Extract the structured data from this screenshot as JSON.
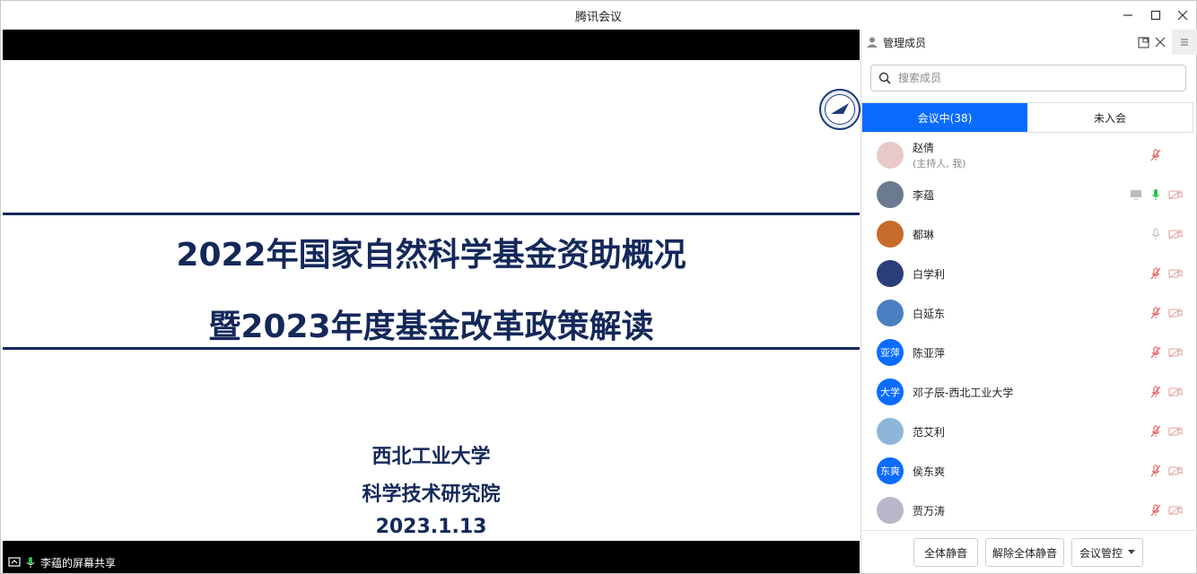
{
  "window": {
    "title": "腾讯会议"
  },
  "window_controls": {
    "minimize": "—",
    "maximize": "☐",
    "close": "✕"
  },
  "slide": {
    "title_line1": "2022年国家自然科学基金资助概况",
    "title_line2": "暨2023年度基金改革政策解读",
    "org1": "西北工业大学",
    "org2": "科学技术研究院",
    "date": "2023.1.13"
  },
  "share_status": {
    "label": "李蕴的屏幕共享"
  },
  "panel": {
    "title": "管理成员",
    "search_placeholder": "搜索成员",
    "tabs": [
      {
        "label": "会议中(38)",
        "active": true
      },
      {
        "label": "未入会",
        "active": false
      }
    ],
    "members": [
      {
        "name": "赵倩",
        "sub": "(主持人, 我)",
        "avatar_color": "#e8c9c9",
        "mic": "muted",
        "video": false,
        "screen": false
      },
      {
        "name": "李蕴",
        "sub": "",
        "avatar_color": "#6b7a8f",
        "mic": "active",
        "video": "off",
        "screen": true
      },
      {
        "name": "都琳",
        "sub": "",
        "avatar_color": "#c76b2b",
        "mic": "idle",
        "video": "off",
        "screen": false
      },
      {
        "name": "白学利",
        "sub": "",
        "avatar_color": "#2c3e7a",
        "mic": "muted",
        "video": "off",
        "screen": false
      },
      {
        "name": "白延东",
        "sub": "",
        "avatar_color": "#4a7fc1",
        "mic": "muted",
        "video": "off",
        "screen": false
      },
      {
        "name": "陈亚萍",
        "sub": "",
        "avatar_text": "亚萍",
        "avatar_color": "#0a6cff",
        "mic": "muted",
        "video": "off",
        "screen": false
      },
      {
        "name": "邓子辰-西北工业大学",
        "sub": "",
        "avatar_text": "大学",
        "avatar_color": "#0a6cff",
        "mic": "muted",
        "video": "off",
        "screen": false
      },
      {
        "name": "范艾利",
        "sub": "",
        "avatar_color": "#8fb6d8",
        "mic": "muted",
        "video": "off",
        "screen": false
      },
      {
        "name": "侯东爽",
        "sub": "",
        "avatar_text": "东爽",
        "avatar_color": "#0a6cff",
        "mic": "muted",
        "video": "off",
        "screen": false
      },
      {
        "name": "贾万涛",
        "sub": "",
        "avatar_color": "#b7b7c9",
        "mic": "muted",
        "video": "off",
        "screen": false
      }
    ],
    "footer": {
      "mute_all": "全体静音",
      "unmute_all": "解除全体静音",
      "meeting_control": "会议管控"
    }
  },
  "colors": {
    "accent": "#0a6cff",
    "slide_navy": "#14285a",
    "muted_red": "#e05a5a",
    "mic_green": "#2bbf4a"
  }
}
